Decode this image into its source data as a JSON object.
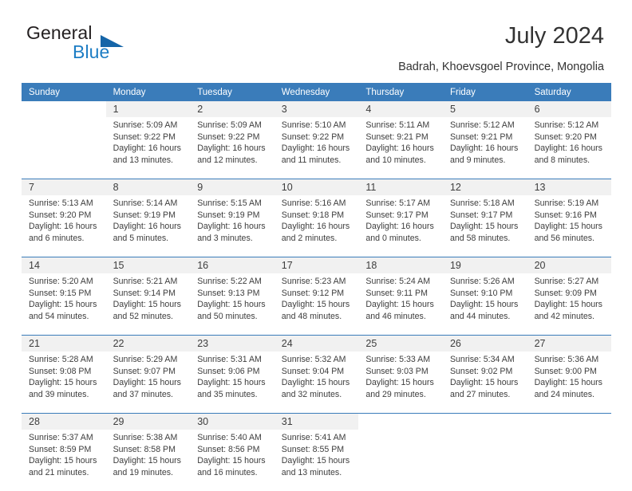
{
  "brand": {
    "name_part1": "General",
    "name_part2": "Blue",
    "triangle_color": "#1565a8",
    "blue_color": "#1d7dc4"
  },
  "header": {
    "title": "July 2024",
    "subtitle": "Badrah, Khoevsgoel Province, Mongolia",
    "header_bg": "#3a7cba",
    "header_text_color": "#ffffff"
  },
  "weekday_headers": [
    "Sunday",
    "Monday",
    "Tuesday",
    "Wednesday",
    "Thursday",
    "Friday",
    "Saturday"
  ],
  "weeks": [
    {
      "days": [
        {
          "num": "",
          "lines": []
        },
        {
          "num": "1",
          "lines": [
            "Sunrise: 5:09 AM",
            "Sunset: 9:22 PM",
            "Daylight: 16 hours",
            "and 13 minutes."
          ]
        },
        {
          "num": "2",
          "lines": [
            "Sunrise: 5:09 AM",
            "Sunset: 9:22 PM",
            "Daylight: 16 hours",
            "and 12 minutes."
          ]
        },
        {
          "num": "3",
          "lines": [
            "Sunrise: 5:10 AM",
            "Sunset: 9:22 PM",
            "Daylight: 16 hours",
            "and 11 minutes."
          ]
        },
        {
          "num": "4",
          "lines": [
            "Sunrise: 5:11 AM",
            "Sunset: 9:21 PM",
            "Daylight: 16 hours",
            "and 10 minutes."
          ]
        },
        {
          "num": "5",
          "lines": [
            "Sunrise: 5:12 AM",
            "Sunset: 9:21 PM",
            "Daylight: 16 hours",
            "and 9 minutes."
          ]
        },
        {
          "num": "6",
          "lines": [
            "Sunrise: 5:12 AM",
            "Sunset: 9:20 PM",
            "Daylight: 16 hours",
            "and 8 minutes."
          ]
        }
      ]
    },
    {
      "days": [
        {
          "num": "7",
          "lines": [
            "Sunrise: 5:13 AM",
            "Sunset: 9:20 PM",
            "Daylight: 16 hours",
            "and 6 minutes."
          ]
        },
        {
          "num": "8",
          "lines": [
            "Sunrise: 5:14 AM",
            "Sunset: 9:19 PM",
            "Daylight: 16 hours",
            "and 5 minutes."
          ]
        },
        {
          "num": "9",
          "lines": [
            "Sunrise: 5:15 AM",
            "Sunset: 9:19 PM",
            "Daylight: 16 hours",
            "and 3 minutes."
          ]
        },
        {
          "num": "10",
          "lines": [
            "Sunrise: 5:16 AM",
            "Sunset: 9:18 PM",
            "Daylight: 16 hours",
            "and 2 minutes."
          ]
        },
        {
          "num": "11",
          "lines": [
            "Sunrise: 5:17 AM",
            "Sunset: 9:17 PM",
            "Daylight: 16 hours",
            "and 0 minutes."
          ]
        },
        {
          "num": "12",
          "lines": [
            "Sunrise: 5:18 AM",
            "Sunset: 9:17 PM",
            "Daylight: 15 hours",
            "and 58 minutes."
          ]
        },
        {
          "num": "13",
          "lines": [
            "Sunrise: 5:19 AM",
            "Sunset: 9:16 PM",
            "Daylight: 15 hours",
            "and 56 minutes."
          ]
        }
      ]
    },
    {
      "days": [
        {
          "num": "14",
          "lines": [
            "Sunrise: 5:20 AM",
            "Sunset: 9:15 PM",
            "Daylight: 15 hours",
            "and 54 minutes."
          ]
        },
        {
          "num": "15",
          "lines": [
            "Sunrise: 5:21 AM",
            "Sunset: 9:14 PM",
            "Daylight: 15 hours",
            "and 52 minutes."
          ]
        },
        {
          "num": "16",
          "lines": [
            "Sunrise: 5:22 AM",
            "Sunset: 9:13 PM",
            "Daylight: 15 hours",
            "and 50 minutes."
          ]
        },
        {
          "num": "17",
          "lines": [
            "Sunrise: 5:23 AM",
            "Sunset: 9:12 PM",
            "Daylight: 15 hours",
            "and 48 minutes."
          ]
        },
        {
          "num": "18",
          "lines": [
            "Sunrise: 5:24 AM",
            "Sunset: 9:11 PM",
            "Daylight: 15 hours",
            "and 46 minutes."
          ]
        },
        {
          "num": "19",
          "lines": [
            "Sunrise: 5:26 AM",
            "Sunset: 9:10 PM",
            "Daylight: 15 hours",
            "and 44 minutes."
          ]
        },
        {
          "num": "20",
          "lines": [
            "Sunrise: 5:27 AM",
            "Sunset: 9:09 PM",
            "Daylight: 15 hours",
            "and 42 minutes."
          ]
        }
      ]
    },
    {
      "days": [
        {
          "num": "21",
          "lines": [
            "Sunrise: 5:28 AM",
            "Sunset: 9:08 PM",
            "Daylight: 15 hours",
            "and 39 minutes."
          ]
        },
        {
          "num": "22",
          "lines": [
            "Sunrise: 5:29 AM",
            "Sunset: 9:07 PM",
            "Daylight: 15 hours",
            "and 37 minutes."
          ]
        },
        {
          "num": "23",
          "lines": [
            "Sunrise: 5:31 AM",
            "Sunset: 9:06 PM",
            "Daylight: 15 hours",
            "and 35 minutes."
          ]
        },
        {
          "num": "24",
          "lines": [
            "Sunrise: 5:32 AM",
            "Sunset: 9:04 PM",
            "Daylight: 15 hours",
            "and 32 minutes."
          ]
        },
        {
          "num": "25",
          "lines": [
            "Sunrise: 5:33 AM",
            "Sunset: 9:03 PM",
            "Daylight: 15 hours",
            "and 29 minutes."
          ]
        },
        {
          "num": "26",
          "lines": [
            "Sunrise: 5:34 AM",
            "Sunset: 9:02 PM",
            "Daylight: 15 hours",
            "and 27 minutes."
          ]
        },
        {
          "num": "27",
          "lines": [
            "Sunrise: 5:36 AM",
            "Sunset: 9:00 PM",
            "Daylight: 15 hours",
            "and 24 minutes."
          ]
        }
      ]
    },
    {
      "days": [
        {
          "num": "28",
          "lines": [
            "Sunrise: 5:37 AM",
            "Sunset: 8:59 PM",
            "Daylight: 15 hours",
            "and 21 minutes."
          ]
        },
        {
          "num": "29",
          "lines": [
            "Sunrise: 5:38 AM",
            "Sunset: 8:58 PM",
            "Daylight: 15 hours",
            "and 19 minutes."
          ]
        },
        {
          "num": "30",
          "lines": [
            "Sunrise: 5:40 AM",
            "Sunset: 8:56 PM",
            "Daylight: 15 hours",
            "and 16 minutes."
          ]
        },
        {
          "num": "31",
          "lines": [
            "Sunrise: 5:41 AM",
            "Sunset: 8:55 PM",
            "Daylight: 15 hours",
            "and 13 minutes."
          ]
        },
        {
          "num": "",
          "lines": []
        },
        {
          "num": "",
          "lines": []
        },
        {
          "num": "",
          "lines": []
        }
      ]
    }
  ]
}
